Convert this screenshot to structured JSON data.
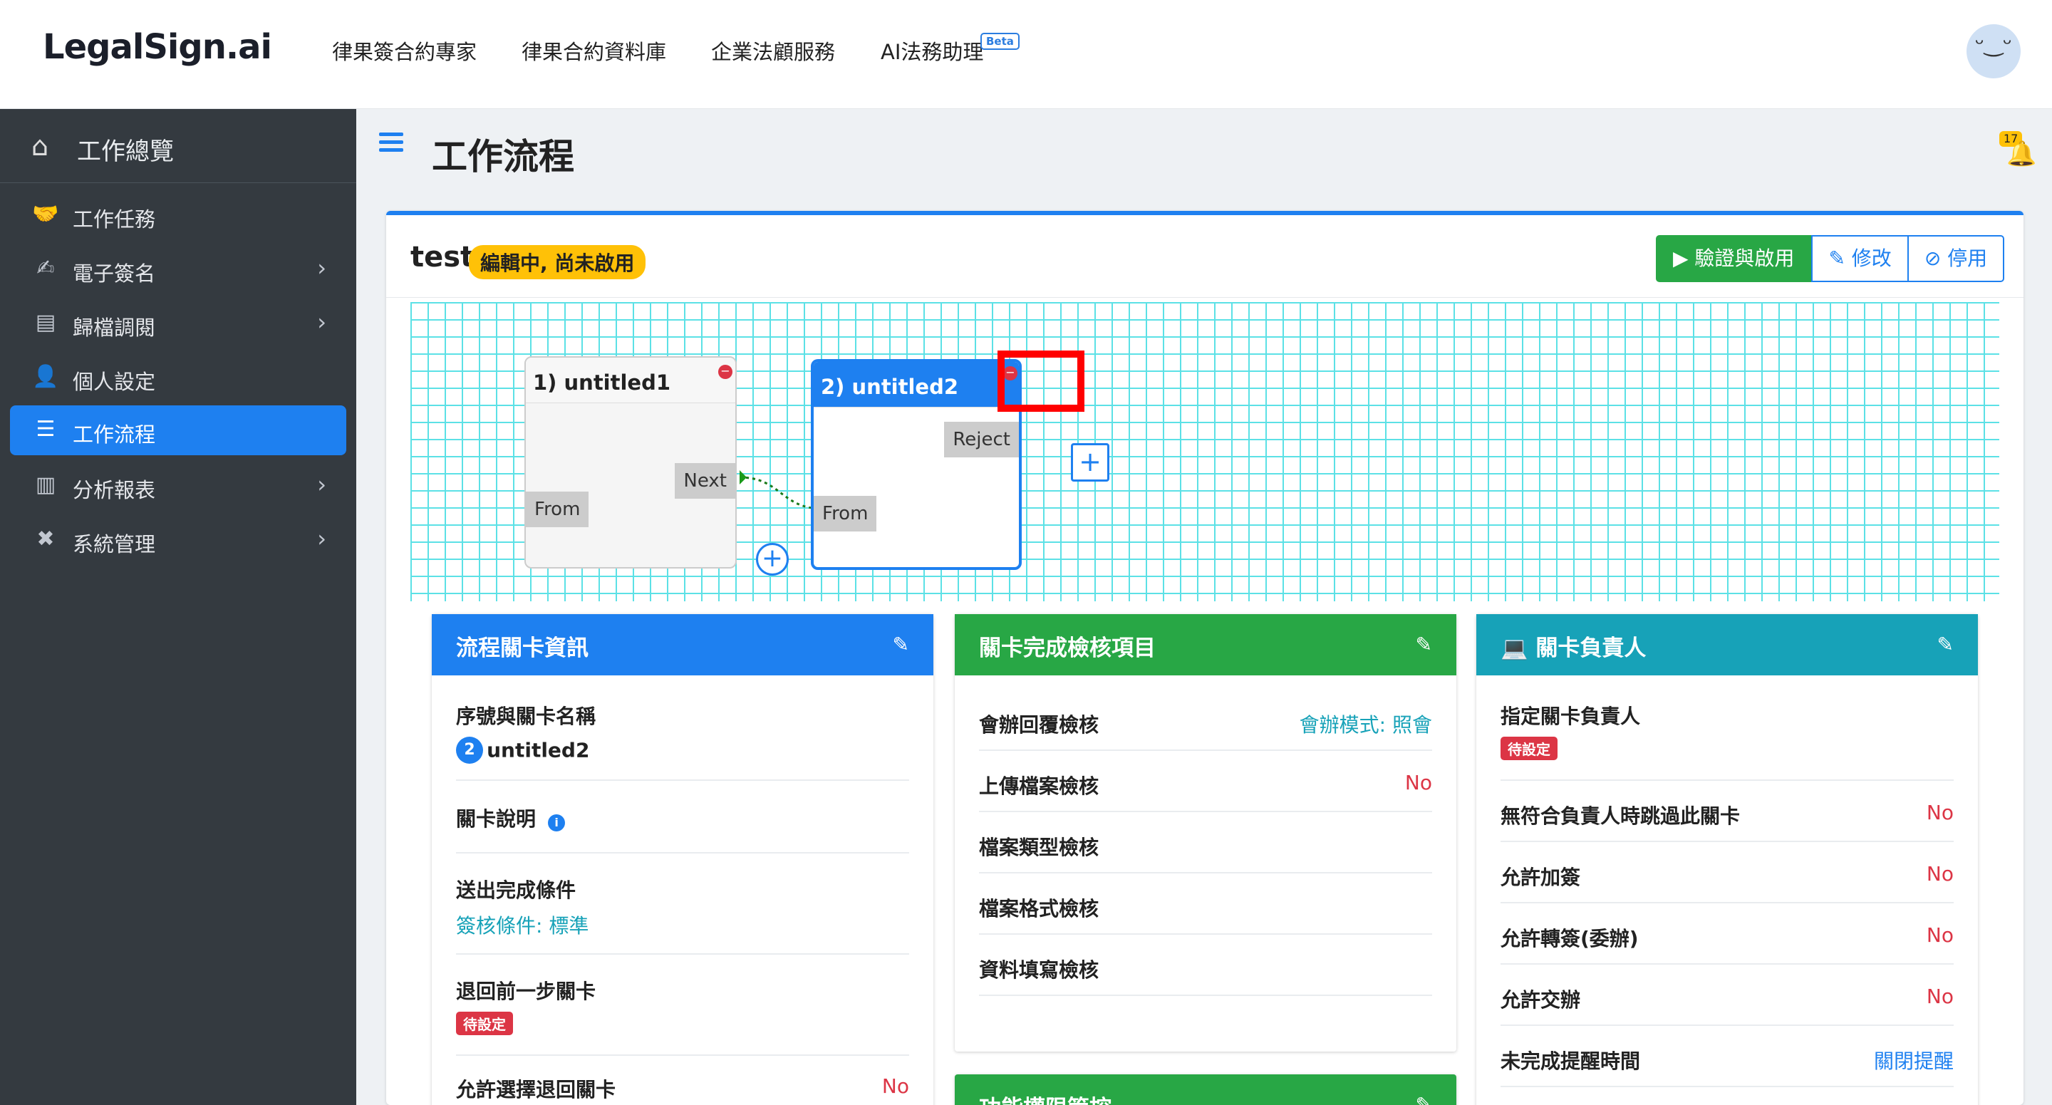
{
  "brand": {
    "logo": "LegalSign.ai"
  },
  "topnav": {
    "items": [
      "律果簽合約專家",
      "律果合約資料庫",
      "企業法顧服務",
      "AI法務助理"
    ],
    "beta": "Beta",
    "avatar_face": "ᵕ‿ᵕ"
  },
  "sidebar": {
    "header": "工作總覽",
    "items": [
      {
        "label": "工作任務",
        "icon": "handshake-icon"
      },
      {
        "label": "電子簽名",
        "icon": "signature-icon"
      },
      {
        "label": "歸檔調閱",
        "icon": "archive-icon"
      },
      {
        "label": "個人設定",
        "icon": "user-cog-icon"
      },
      {
        "label": "工作流程",
        "icon": "list-icon"
      },
      {
        "label": "分析報表",
        "icon": "chart-icon"
      },
      {
        "label": "系統管理",
        "icon": "tools-icon"
      }
    ]
  },
  "header": {
    "title": "工作流程",
    "bell_count": "17"
  },
  "workflow": {
    "name": "test",
    "status": "編輯中, 尚未啟用",
    "buttons": {
      "validate": "▶ 驗證與啟用",
      "edit": "✎ 修改",
      "disable": "⊘ 停用"
    }
  },
  "canvas": {
    "node1": {
      "title": "1) untitled1",
      "out_port": "Next",
      "in_port": "From"
    },
    "node2": {
      "title": "2) untitled2",
      "out_port": "Reject",
      "in_port": "From"
    }
  },
  "panel_info": {
    "title": "流程關卡資訊",
    "seq_label": "序號與關卡名稱",
    "seq_num": "2",
    "seq_name": "untitled2",
    "desc_label": "關卡說明",
    "submit_label": "送出完成條件",
    "submit_value": "簽核條件: 標準",
    "return_label": "退回前一步關卡",
    "return_value": "待設定",
    "allow_return_label": "允許選擇退回關卡",
    "allow_return_value": "No"
  },
  "panel_check": {
    "title": "關卡完成檢核項目",
    "rows": [
      {
        "label": "會辦回覆檢核",
        "value": "會辦模式: 照會"
      },
      {
        "label": "上傳檔案檢核",
        "value": "No"
      },
      {
        "label": "檔案類型檢核",
        "value": ""
      },
      {
        "label": "檔案格式檢核",
        "value": ""
      },
      {
        "label": "資料填寫檢核",
        "value": ""
      }
    ],
    "second_title": "功能權限管控"
  },
  "panel_owner": {
    "title": "關卡負責人",
    "assign_label": "指定關卡負責人",
    "assign_value": "待設定",
    "rows": [
      {
        "label": "無符合負責人時跳過此關卡",
        "value": "No"
      },
      {
        "label": "允許加簽",
        "value": "No"
      },
      {
        "label": "允許轉簽(委辦)",
        "value": "No"
      },
      {
        "label": "允許交辦",
        "value": "No"
      },
      {
        "label": "未完成提醒時間",
        "value": "關閉提醒"
      }
    ]
  }
}
